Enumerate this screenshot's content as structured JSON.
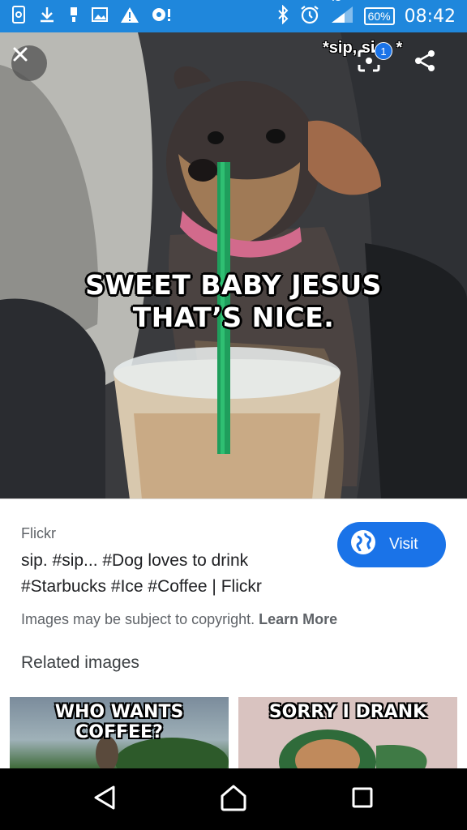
{
  "status_bar": {
    "network": "4G",
    "battery": "60%",
    "time": "08:42",
    "icons": [
      "screenshot-icon",
      "download-icon",
      "sim-icon",
      "image-icon",
      "warning-icon",
      "notification-icon",
      "bluetooth-icon",
      "alarm-icon",
      "signal-icon"
    ]
  },
  "hero": {
    "overlay_text": "*sip, si",
    "overlay_suffix": "*",
    "lens_badge": "1",
    "caption_line1": "SWEET BABY JESUS",
    "caption_line2": "THAT’S NICE."
  },
  "result": {
    "source": "Flickr",
    "title": "sip. #sip... #Dog loves to drink #Starbucks #Ice #Coffee | Flickr",
    "visit_label": "Visit",
    "copyright_text": "Images may be subject to copyright.",
    "learn_more": "Learn More"
  },
  "related": {
    "heading": "Related images",
    "items": [
      {
        "caption": "WHO WANTS COFFEE?"
      },
      {
        "caption": "SORRY I DRANK"
      }
    ]
  },
  "colors": {
    "status_bar": "#1f87dc",
    "accent": "#1a73e8"
  }
}
